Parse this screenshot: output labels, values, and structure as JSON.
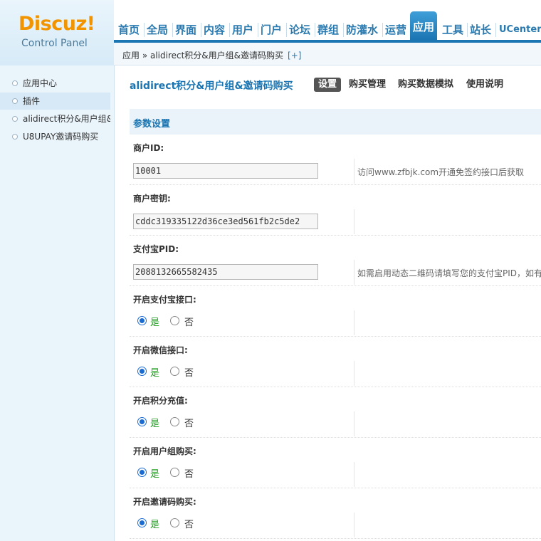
{
  "header": {
    "logo": "Discuz!",
    "subtitle": "Control Panel",
    "nav": [
      "首页",
      "全局",
      "界面",
      "内容",
      "用户",
      "门户",
      "论坛",
      "群组",
      "防灌水",
      "运营",
      "应用",
      "工具",
      "站长",
      "UCenter"
    ],
    "active_nav": "应用",
    "breadcrumb": "应用 » alidirect积分&用户组&邀请码购买",
    "breadcrumb_plus": "[+]"
  },
  "sidebar": {
    "items": [
      {
        "label": "应用中心"
      },
      {
        "label": "插件"
      },
      {
        "label": "alidirect积分&用户组&"
      },
      {
        "label": "U8UPAY邀请码购买"
      }
    ]
  },
  "plugin": {
    "title": "alidirect积分&用户组&邀请码购买",
    "tabs": [
      "设置",
      "购买管理",
      "购买数据模拟",
      "使用说明"
    ]
  },
  "section": {
    "title": "参数设置",
    "fields": [
      {
        "label": "商户ID:",
        "value": "10001",
        "hint": "访问www.zfbjk.com开通免签约接口后获取"
      },
      {
        "label": "商户密钥:",
        "value": "cddc319335122d36ce3ed561fb2c5de2",
        "hint": ""
      },
      {
        "label": "支付宝PID:",
        "value": "2088132665582435",
        "hint": "如需启用动态二维码请填写您的支付宝PID，如有"
      }
    ],
    "toggles": [
      {
        "label": "开启支付宝接口:",
        "yes": "是",
        "no": "否",
        "selected": "yes"
      },
      {
        "label": "开启微信接口:",
        "yes": "是",
        "no": "否",
        "selected": "yes"
      },
      {
        "label": "开启积分充值:",
        "yes": "是",
        "no": "否",
        "selected": "yes"
      },
      {
        "label": "开启用户组购买:",
        "yes": "是",
        "no": "否",
        "selected": "yes"
      },
      {
        "label": "开启邀请码购买:",
        "yes": "是",
        "no": "否",
        "selected": "yes"
      }
    ]
  }
}
